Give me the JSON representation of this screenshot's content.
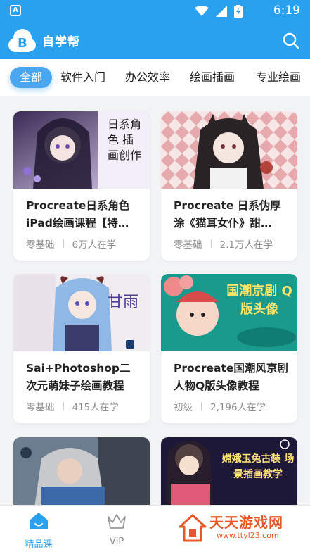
{
  "status_bar": {
    "time": "6:19",
    "app_letter": "A"
  },
  "app_bar": {
    "title": "自学帮",
    "logo_letter": "B"
  },
  "tabs": [
    {
      "label": "全部",
      "active": true
    },
    {
      "label": "软件入门"
    },
    {
      "label": "办公效率"
    },
    {
      "label": "绘画插画"
    },
    {
      "label": "专业绘画"
    }
  ],
  "courses": [
    {
      "title": "Procreate日系角色iPad绘画课程【特…",
      "level": "零基础",
      "students": "6万人在学",
      "thumb_text": "日系角色 插画创作"
    },
    {
      "title": "Procreate 日系伪厚涂《猫耳女仆》甜…",
      "level": "零基础",
      "students": "2.1万人在学",
      "thumb_text": ""
    },
    {
      "title": "Sai+Photoshop二次元萌妹子绘画教程",
      "level": "零基础",
      "students": "415人在学",
      "thumb_text": "甘雨"
    },
    {
      "title": "Procreate国潮风京剧人物Q版头像教程",
      "level": "初级",
      "students": "2,196人在学",
      "thumb_text": "国潮京剧 Q版头像"
    },
    {
      "title": "",
      "level": "",
      "students": "",
      "thumb_text": ""
    },
    {
      "title": "",
      "level": "",
      "students": "",
      "thumb_text": "嫦娥玉兔古装 场景插画教学"
    }
  ],
  "bottom_nav": [
    {
      "label": "精品课",
      "active": true
    },
    {
      "label": "VIP"
    }
  ],
  "watermark": {
    "name": "天天游戏网",
    "url": "www.ttyl23.com"
  },
  "colors": {
    "primary": "#2aa1ee",
    "tab_active": "#4aa7ef",
    "watermark": "#e65a28"
  }
}
